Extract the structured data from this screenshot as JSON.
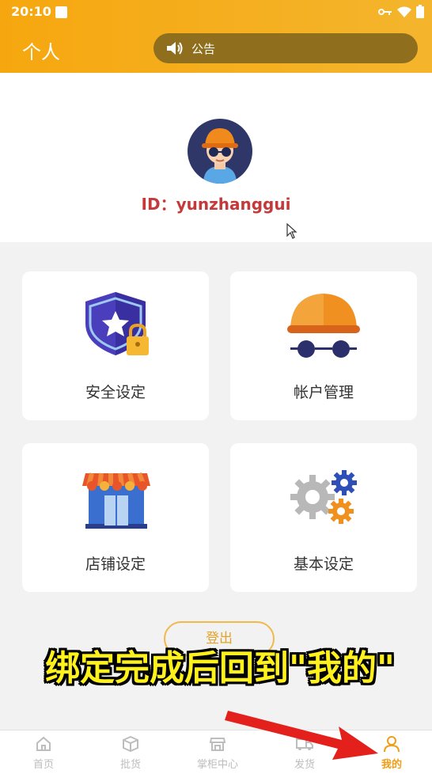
{
  "status_bar": {
    "time": "20:10"
  },
  "header": {
    "title": "个人",
    "notice_label": "公告"
  },
  "profile": {
    "id_text": "ID：yunzhanggui"
  },
  "cards": [
    {
      "label": "安全设定",
      "icon": "shield-lock-icon"
    },
    {
      "label": "帐户管理",
      "icon": "account-cap-icon"
    },
    {
      "label": "店铺设定",
      "icon": "store-icon"
    },
    {
      "label": "基本设定",
      "icon": "gears-icon"
    }
  ],
  "logout_label": "登出",
  "caption": "绑定完成后回到\"我的\"",
  "tabs": [
    {
      "label": "首页",
      "icon": "home-icon"
    },
    {
      "label": "批货",
      "icon": "box-icon"
    },
    {
      "label": "掌柜中心",
      "icon": "shop-icon"
    },
    {
      "label": "发货",
      "icon": "truck-icon"
    },
    {
      "label": "我的",
      "icon": "user-icon",
      "active": true
    }
  ],
  "colors": {
    "accent": "#f6a70f",
    "id_text": "#c43a3a",
    "caption": "#fff11c",
    "active_tab": "#f09e16"
  }
}
